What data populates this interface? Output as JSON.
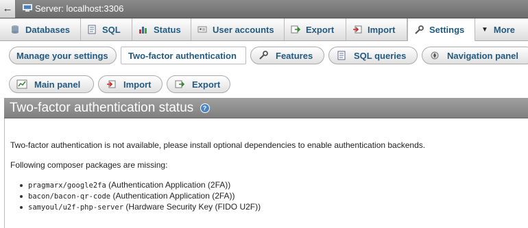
{
  "top_bar": {
    "back_symbol": "←",
    "server_label": "Server: localhost:3306"
  },
  "main_tabs": [
    {
      "label": "Databases",
      "icon": "database-icon"
    },
    {
      "label": "SQL",
      "icon": "sql-icon"
    },
    {
      "label": "Status",
      "icon": "status-chart-icon"
    },
    {
      "label": "User accounts",
      "icon": "user-accounts-icon"
    },
    {
      "label": "Export",
      "icon": "export-icon"
    },
    {
      "label": "Import",
      "icon": "import-icon"
    },
    {
      "label": "Settings",
      "icon": "wrench-icon",
      "active": true
    },
    {
      "label": "More",
      "icon": "caret-down-icon"
    }
  ],
  "sub_tabs": [
    {
      "label": "Manage your settings"
    },
    {
      "label": "Two-factor authentication",
      "active": true
    },
    {
      "label": "Features",
      "icon": "wrench-icon"
    },
    {
      "label": "SQL queries",
      "icon": "sql-icon"
    },
    {
      "label": "Navigation panel",
      "icon": "navigation-icon"
    },
    {
      "label": "Main panel",
      "icon": "main-panel-icon"
    },
    {
      "label": "Import",
      "icon": "import-icon"
    },
    {
      "label": "Export",
      "icon": "export-icon"
    }
  ],
  "section": {
    "title": "Two-factor authentication status",
    "help_glyph": "?",
    "message": "Two-factor authentication is not available, please install optional dependencies to enable authentication backends.",
    "missing_heading": "Following composer packages are missing:",
    "packages": [
      {
        "name": "pragmarx/google2fa",
        "desc": "(Authentication Application (2FA))"
      },
      {
        "name": "bacon/bacon-qr-code",
        "desc": "(Authentication Application (2FA))"
      },
      {
        "name": "samyoul/u2f-php-server",
        "desc": "(Hardware Security Key (FIDO U2F))"
      }
    ]
  },
  "colors": {
    "link": "#235a81",
    "header_gray": "#8c8c8c"
  }
}
